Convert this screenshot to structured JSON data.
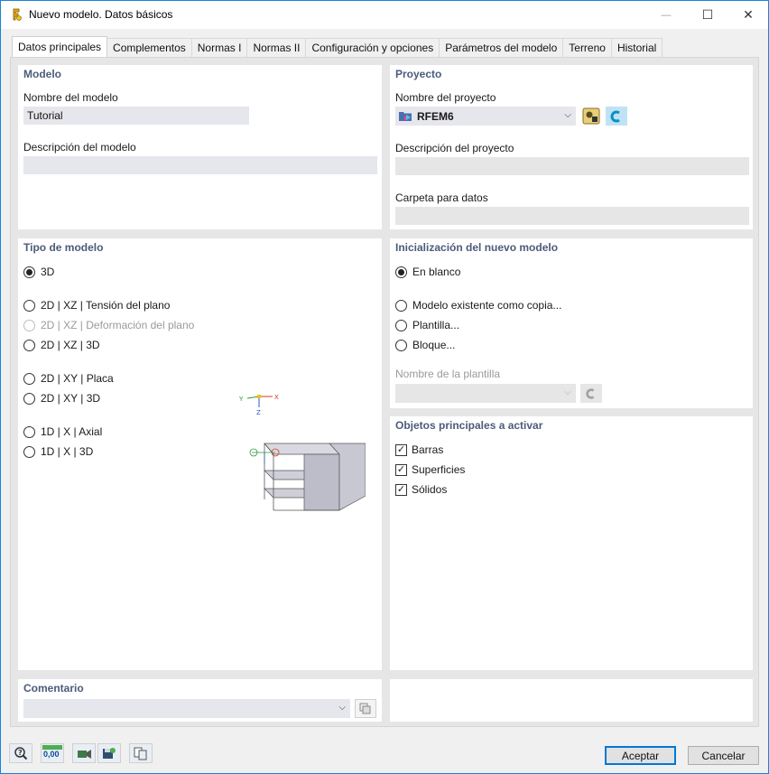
{
  "window": {
    "title": "Nuevo modelo. Datos básicos",
    "minimize_glyph": "—",
    "maximize_glyph": "☐",
    "close_glyph": "✕"
  },
  "tabs": [
    {
      "label": "Datos principales"
    },
    {
      "label": "Complementos"
    },
    {
      "label": "Normas I"
    },
    {
      "label": "Normas II"
    },
    {
      "label": "Configuración y opciones"
    },
    {
      "label": "Parámetros del modelo"
    },
    {
      "label": "Terreno"
    },
    {
      "label": "Historial"
    }
  ],
  "modelo": {
    "title": "Modelo",
    "name_label": "Nombre del modelo",
    "name_value": "Tutorial",
    "desc_label": "Descripción del modelo",
    "desc_value": ""
  },
  "proyecto": {
    "title": "Proyecto",
    "name_label": "Nombre del proyecto",
    "name_value": "RFEM6",
    "desc_label": "Descripción del proyecto",
    "desc_value": "",
    "folder_label": "Carpeta para datos",
    "folder_value": ""
  },
  "tipo": {
    "title": "Tipo de modelo",
    "options": [
      {
        "label": "3D"
      },
      {
        "label": "2D | XZ | Tensión del plano"
      },
      {
        "label": "2D | XZ | Deformación del plano"
      },
      {
        "label": "2D | XZ | 3D"
      },
      {
        "label": "2D | XY | Placa"
      },
      {
        "label": "2D | XY | 3D"
      },
      {
        "label": "1D | X | Axial"
      },
      {
        "label": "1D | X | 3D"
      }
    ],
    "axis_x": "X",
    "axis_y": "Y",
    "axis_z": "Z"
  },
  "init": {
    "title": "Inicialización del nuevo modelo",
    "options": [
      {
        "label": "En blanco"
      },
      {
        "label": "Modelo existente como copia..."
      },
      {
        "label": "Plantilla..."
      },
      {
        "label": "Bloque..."
      }
    ],
    "template_label": "Nombre de la plantilla",
    "template_value": ""
  },
  "objetos": {
    "title": "Objetos principales a activar",
    "items": [
      {
        "label": "Barras"
      },
      {
        "label": "Superficies"
      },
      {
        "label": "Sólidos"
      }
    ]
  },
  "comentario": {
    "title": "Comentario",
    "value": ""
  },
  "footer": {
    "units_label": "0,00",
    "accept_label": "Aceptar",
    "cancel_label": "Cancelar"
  },
  "colors": {
    "accent": "#0078d7",
    "panel_title": "#4b5b7a",
    "field_bg": "#e6e6ed"
  }
}
